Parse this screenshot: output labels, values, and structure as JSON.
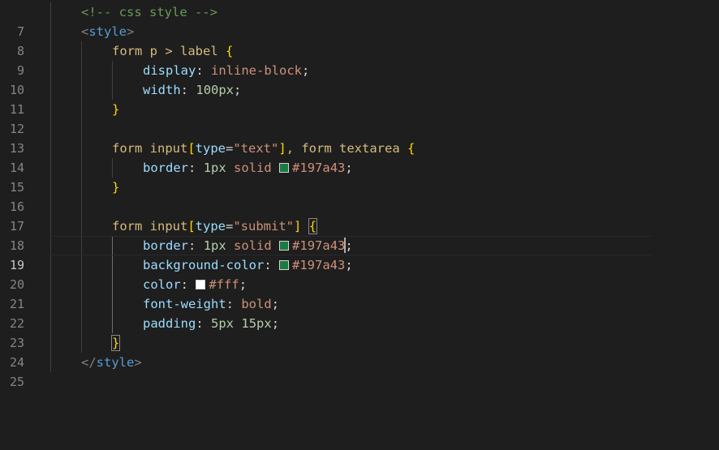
{
  "editor": {
    "colors": {
      "green_swatch": "#197a43",
      "white_swatch": "#ffffff"
    },
    "lines": [
      {
        "n": "7",
        "t": [
          "<!-- css style -->"
        ]
      },
      {
        "n": "8",
        "t": [
          "<",
          "style",
          ">"
        ]
      },
      {
        "n": "9",
        "t": [
          "form p > label",
          "{"
        ]
      },
      {
        "n": "10",
        "t": [
          "display",
          ":",
          "inline-block",
          ";"
        ]
      },
      {
        "n": "11",
        "t": [
          "width",
          ":",
          "100px",
          ";"
        ]
      },
      {
        "n": "12",
        "t": [
          "}"
        ]
      },
      {
        "n": "13",
        "t": []
      },
      {
        "n": "14",
        "t": [
          "form input",
          "[",
          "type",
          "=",
          "\"text\"",
          "]",
          ", form textarea",
          "{"
        ]
      },
      {
        "n": "15",
        "t": [
          "border",
          ":",
          "1px",
          "solid",
          "#197a43",
          ";"
        ]
      },
      {
        "n": "16",
        "t": [
          "}"
        ]
      },
      {
        "n": "17",
        "t": []
      },
      {
        "n": "18",
        "t": [
          "form input",
          "[",
          "type",
          "=",
          "\"submit\"",
          "]",
          "{"
        ]
      },
      {
        "n": "19",
        "t": [
          "border",
          ":",
          "1px",
          "solid",
          "#197a43",
          ";"
        ]
      },
      {
        "n": "20",
        "t": [
          "background-color",
          ":",
          "#197a43",
          ";"
        ]
      },
      {
        "n": "21",
        "t": [
          "color",
          ":",
          "#fff",
          ";"
        ]
      },
      {
        "n": "22",
        "t": [
          "font-weight",
          ":",
          "bold",
          ";"
        ]
      },
      {
        "n": "23",
        "t": [
          "padding",
          ":",
          "5px",
          "15px",
          ";"
        ]
      },
      {
        "n": "24",
        "t": [
          "}"
        ]
      },
      {
        "n": "25",
        "t": [
          "</",
          "style",
          ">"
        ]
      }
    ]
  }
}
